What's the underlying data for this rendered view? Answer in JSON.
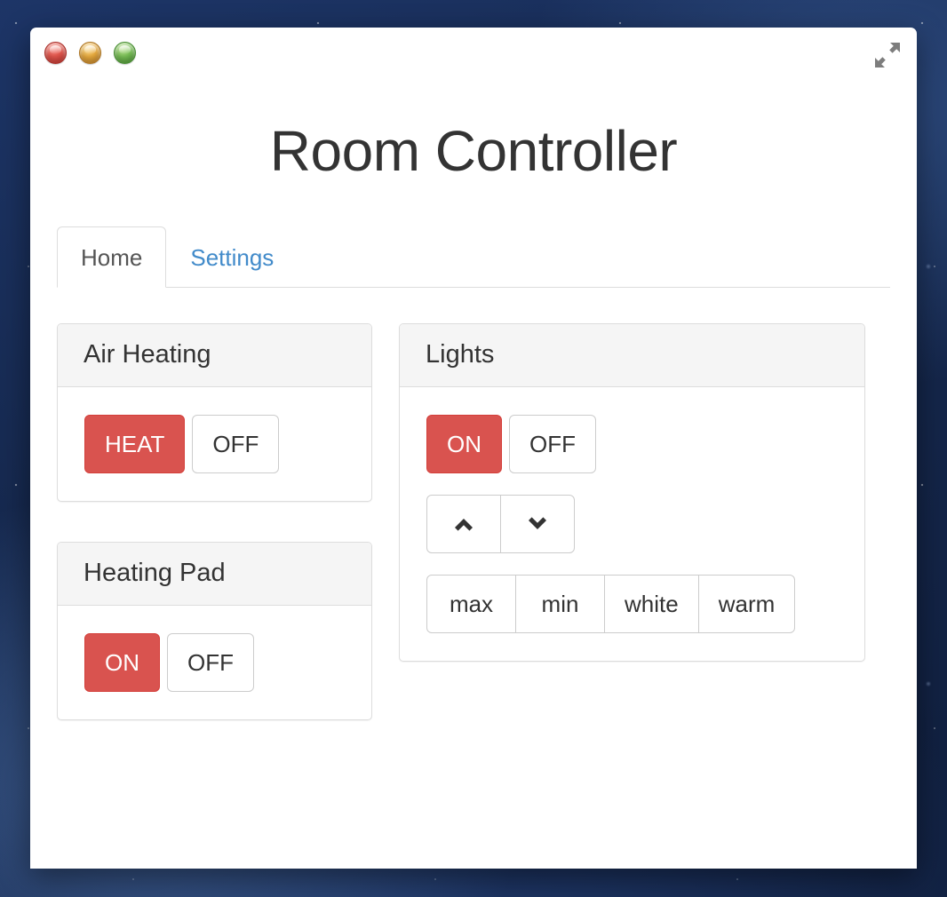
{
  "window": {
    "traffic_lights": [
      {
        "name": "close",
        "color": "#e4574d"
      },
      {
        "name": "minimize",
        "color": "#e9ab3e"
      },
      {
        "name": "zoom",
        "color": "#78bf55"
      }
    ],
    "expand_icon": "expand-arrows-icon"
  },
  "page": {
    "title": "Room Controller"
  },
  "tabs": [
    {
      "label": "Home",
      "active": true
    },
    {
      "label": "Settings",
      "active": false
    }
  ],
  "colors": {
    "accent_red": "#d9534f",
    "link_blue": "#428bca",
    "panel_header": "#f5f5f5",
    "border": "#dddddd",
    "text": "#333333"
  },
  "panels": {
    "air_heating": {
      "title": "Air Heating",
      "buttons": [
        {
          "label": "HEAT",
          "state": "active"
        },
        {
          "label": "OFF",
          "state": "default"
        }
      ]
    },
    "heating_pad": {
      "title": "Heating Pad",
      "buttons": [
        {
          "label": "ON",
          "state": "active"
        },
        {
          "label": "OFF",
          "state": "default"
        }
      ]
    },
    "lights": {
      "title": "Lights",
      "power_buttons": [
        {
          "label": "ON",
          "state": "active"
        },
        {
          "label": "OFF",
          "state": "default"
        }
      ],
      "dim_buttons": [
        {
          "icon": "chevron-up-icon"
        },
        {
          "icon": "chevron-down-icon"
        }
      ],
      "preset_buttons": [
        {
          "label": "max"
        },
        {
          "label": "min"
        },
        {
          "label": "white"
        },
        {
          "label": "warm"
        }
      ]
    }
  }
}
